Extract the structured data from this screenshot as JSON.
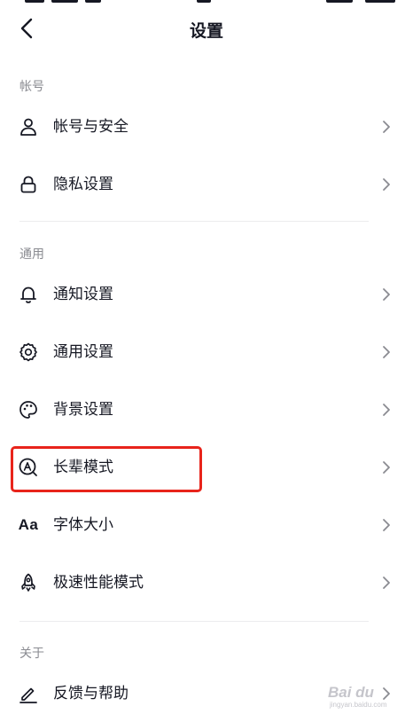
{
  "header": {
    "title": "设置"
  },
  "sections": [
    {
      "title": "帐号",
      "items": [
        {
          "label": "帐号与安全",
          "icon": "user-icon"
        },
        {
          "label": "隐私设置",
          "icon": "lock-icon"
        }
      ]
    },
    {
      "title": "通用",
      "items": [
        {
          "label": "通知设置",
          "icon": "bell-icon"
        },
        {
          "label": "通用设置",
          "icon": "gear-icon"
        },
        {
          "label": "背景设置",
          "icon": "palette-icon"
        },
        {
          "label": "长辈模式",
          "icon": "elder-mode-icon",
          "highlighted": true
        },
        {
          "label": "字体大小",
          "icon": "font-size-icon",
          "icon_text": "Aa"
        },
        {
          "label": "极速性能模式",
          "icon": "rocket-icon"
        }
      ]
    },
    {
      "title": "关于",
      "items": [
        {
          "label": "反馈与帮助",
          "icon": "edit-icon"
        }
      ]
    }
  ],
  "watermark": {
    "logo": "Bai du",
    "subtext": "jingyan.baidu.com"
  },
  "colors": {
    "text": "#161823",
    "secondary_text": "#8a8b91",
    "divider": "#ececee",
    "highlight": "#e8241b"
  }
}
